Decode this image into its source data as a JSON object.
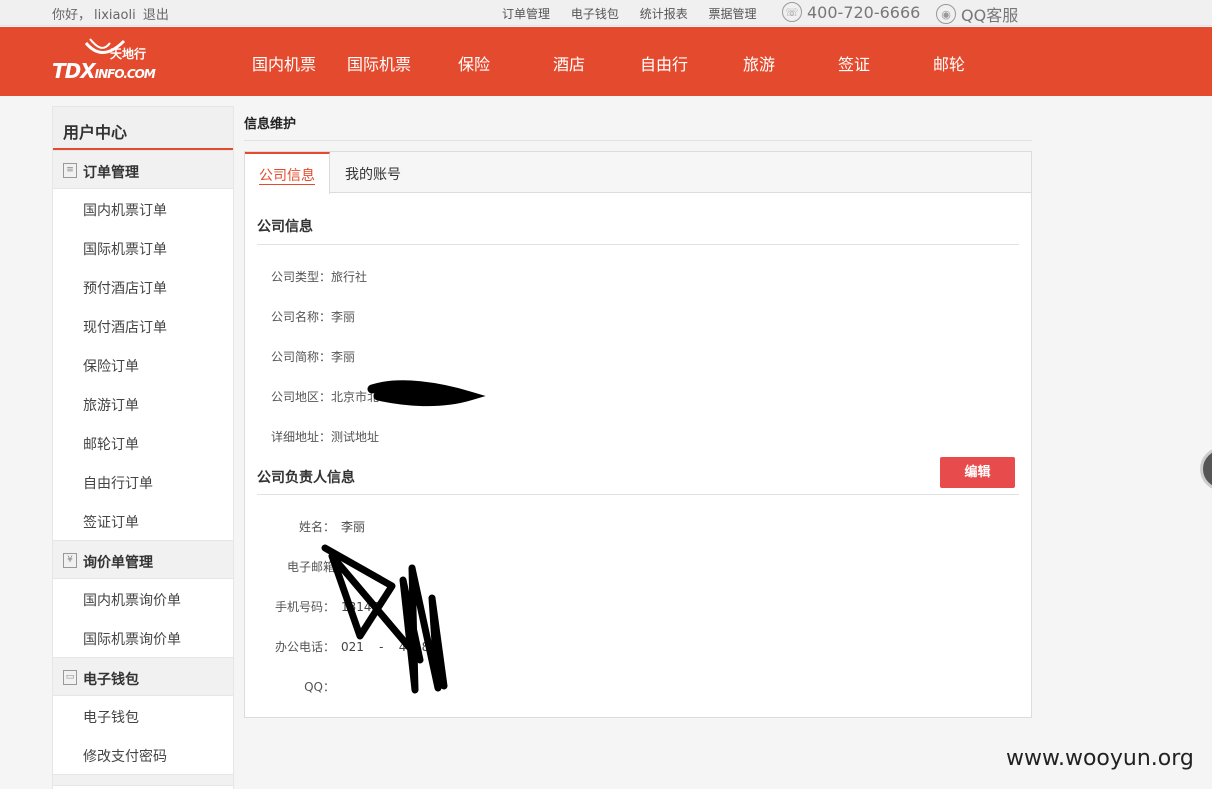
{
  "topbar": {
    "greeting": "你好，",
    "username": "lixiaoli",
    "logout": "退出",
    "links": [
      "订单管理",
      "电子钱包",
      "统计报表",
      "票据管理"
    ],
    "phone": "400-720-6666",
    "qq_service": "QQ客服",
    "phone_icon": "phone-icon",
    "qq_icon": "qq-icon"
  },
  "logo": {
    "main": "TDX",
    "sub": "INFO.COM",
    "cn": "天地行"
  },
  "nav": {
    "items": [
      "国内机票",
      "国际机票",
      "保险",
      "酒店",
      "自由行",
      "旅游",
      "签证",
      "邮轮"
    ]
  },
  "sidebar": {
    "title": "用户中心",
    "groups": [
      {
        "label": "订单管理",
        "icon": "list-icon",
        "items": [
          "国内机票订单",
          "国际机票订单",
          "预付酒店订单",
          "现付酒店订单",
          "保险订单",
          "旅游订单",
          "邮轮订单",
          "自由行订单",
          "签证订单"
        ]
      },
      {
        "label": "询价单管理",
        "icon": "yen-icon",
        "items": [
          "国内机票询价单",
          "国际机票询价单"
        ]
      },
      {
        "label": "电子钱包",
        "icon": "wallet-icon",
        "items": [
          "电子钱包",
          "修改支付密码"
        ]
      }
    ]
  },
  "main": {
    "title": "信息维护",
    "tabs": [
      {
        "label": "公司信息",
        "active": true
      },
      {
        "label": "我的账号",
        "active": false
      }
    ],
    "company": {
      "heading": "公司信息",
      "fields": [
        {
          "label": "公司类型：",
          "value": "旅行社"
        },
        {
          "label": "公司名称：",
          "value": "李丽"
        },
        {
          "label": "公司简称：",
          "value": "李丽"
        },
        {
          "label": "公司地区：",
          "value": "北京市北"
        },
        {
          "label": "详细地址：",
          "value": "测试地址"
        }
      ]
    },
    "contact": {
      "heading": "公司负责人信息",
      "edit_label": "编辑",
      "fields": [
        {
          "label": "姓名：",
          "value": "李丽"
        },
        {
          "label": "电子邮箱",
          "value": ""
        },
        {
          "label": "手机号码：",
          "value": "13145"
        },
        {
          "label": "办公电话：",
          "value": "021    -    4    8"
        },
        {
          "label": "QQ：",
          "value": ""
        }
      ]
    }
  },
  "watermark": "www.wooyun.org",
  "colors": {
    "brand": "#e44b2e",
    "button": "#e84b4b"
  }
}
